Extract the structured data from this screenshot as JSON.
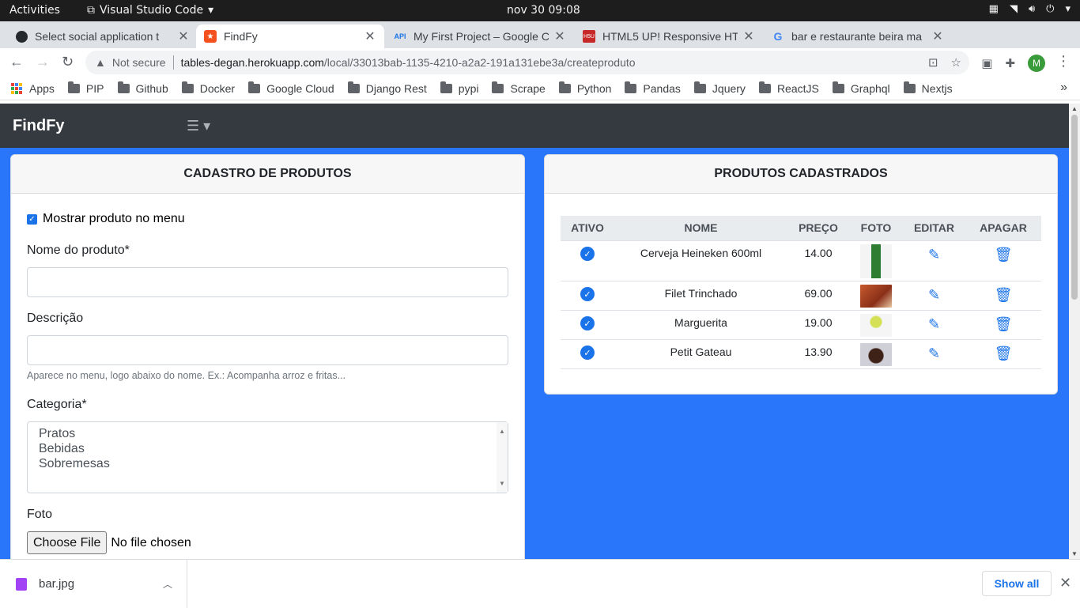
{
  "system": {
    "activities": "Activities",
    "app_name": "Visual Studio Code",
    "clock": "nov 30  09:08"
  },
  "tabs": [
    {
      "title": "Select social application t",
      "icon": "github-favicon"
    },
    {
      "title": "FindFy",
      "icon": "findfy-favicon"
    },
    {
      "title": "My First Project – Google C",
      "icon": "api-favicon"
    },
    {
      "title": "HTML5 UP! Responsive HT",
      "icon": "html5up-favicon"
    },
    {
      "title": "bar e restaurante beira ma",
      "icon": "google-favicon"
    }
  ],
  "address": {
    "security": "Not secure",
    "host": "tables-degan.herokuapp.com",
    "path": "/local/33013bab-1135-4210-a2a2-191a131ebe3a/createproduto",
    "profile_initial": "M"
  },
  "bookmarks": [
    "PIP",
    "Github",
    "Docker",
    "Google Cloud",
    "Django Rest",
    "pypi",
    "Scrape",
    "Python",
    "Pandas",
    "Jquery",
    "ReactJS",
    "Graphql",
    "Nextjs"
  ],
  "bookmarks_apps": "Apps",
  "page": {
    "brand": "FindFy",
    "form": {
      "title": "CADASTRO DE PRODUTOS",
      "show_in_menu": "Mostrar produto no menu",
      "name_label": "Nome do produto*",
      "name_value": "",
      "desc_label": "Descrição",
      "desc_value": "",
      "desc_help": "Aparece no menu, logo abaixo do nome. Ex.: Acompanha arroz e fritas...",
      "category_label": "Categoria*",
      "category_options": [
        "Pratos",
        "Bebidas",
        "Sobremesas"
      ],
      "photo_label": "Foto",
      "file_button": "Choose File",
      "file_status": "No file chosen"
    },
    "products": {
      "title": "PRODUTOS CADASTRADOS",
      "columns": [
        "ATIVO",
        "NOME",
        "PREÇO",
        "FOTO",
        "EDITAR",
        "APAGAR"
      ],
      "rows": [
        {
          "name": "Cerveja Heineken 600ml",
          "price": "14.00"
        },
        {
          "name": "Filet Trinchado",
          "price": "69.00"
        },
        {
          "name": "Marguerita",
          "price": "19.00"
        },
        {
          "name": "Petit Gateau",
          "price": "13.90"
        }
      ]
    }
  },
  "download": {
    "file": "bar.jpg",
    "show_all": "Show all"
  },
  "colors": {
    "page_bg": "#2a76fb",
    "navbar": "#343a40",
    "accent": "#1a73e8"
  }
}
